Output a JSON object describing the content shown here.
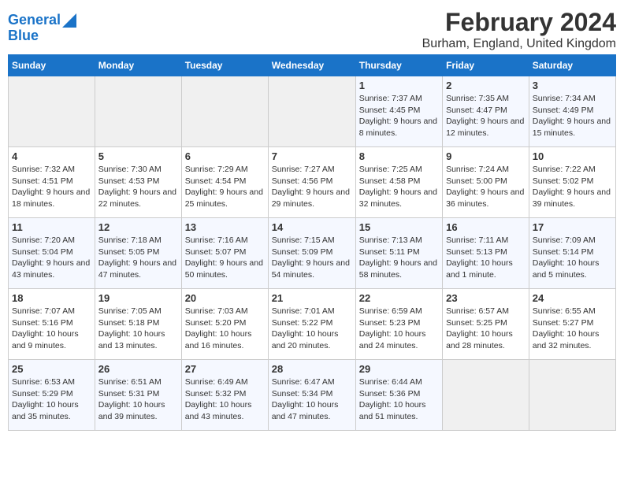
{
  "header": {
    "logo_line1": "General",
    "logo_line2": "Blue",
    "title": "February 2024",
    "subtitle": "Burham, England, United Kingdom"
  },
  "columns": [
    "Sunday",
    "Monday",
    "Tuesday",
    "Wednesday",
    "Thursday",
    "Friday",
    "Saturday"
  ],
  "weeks": [
    [
      {
        "day": "",
        "info": ""
      },
      {
        "day": "",
        "info": ""
      },
      {
        "day": "",
        "info": ""
      },
      {
        "day": "",
        "info": ""
      },
      {
        "day": "1",
        "info": "Sunrise: 7:37 AM\nSunset: 4:45 PM\nDaylight: 9 hours\nand 8 minutes."
      },
      {
        "day": "2",
        "info": "Sunrise: 7:35 AM\nSunset: 4:47 PM\nDaylight: 9 hours\nand 12 minutes."
      },
      {
        "day": "3",
        "info": "Sunrise: 7:34 AM\nSunset: 4:49 PM\nDaylight: 9 hours\nand 15 minutes."
      }
    ],
    [
      {
        "day": "4",
        "info": "Sunrise: 7:32 AM\nSunset: 4:51 PM\nDaylight: 9 hours\nand 18 minutes."
      },
      {
        "day": "5",
        "info": "Sunrise: 7:30 AM\nSunset: 4:53 PM\nDaylight: 9 hours\nand 22 minutes."
      },
      {
        "day": "6",
        "info": "Sunrise: 7:29 AM\nSunset: 4:54 PM\nDaylight: 9 hours\nand 25 minutes."
      },
      {
        "day": "7",
        "info": "Sunrise: 7:27 AM\nSunset: 4:56 PM\nDaylight: 9 hours\nand 29 minutes."
      },
      {
        "day": "8",
        "info": "Sunrise: 7:25 AM\nSunset: 4:58 PM\nDaylight: 9 hours\nand 32 minutes."
      },
      {
        "day": "9",
        "info": "Sunrise: 7:24 AM\nSunset: 5:00 PM\nDaylight: 9 hours\nand 36 minutes."
      },
      {
        "day": "10",
        "info": "Sunrise: 7:22 AM\nSunset: 5:02 PM\nDaylight: 9 hours\nand 39 minutes."
      }
    ],
    [
      {
        "day": "11",
        "info": "Sunrise: 7:20 AM\nSunset: 5:04 PM\nDaylight: 9 hours\nand 43 minutes."
      },
      {
        "day": "12",
        "info": "Sunrise: 7:18 AM\nSunset: 5:05 PM\nDaylight: 9 hours\nand 47 minutes."
      },
      {
        "day": "13",
        "info": "Sunrise: 7:16 AM\nSunset: 5:07 PM\nDaylight: 9 hours\nand 50 minutes."
      },
      {
        "day": "14",
        "info": "Sunrise: 7:15 AM\nSunset: 5:09 PM\nDaylight: 9 hours\nand 54 minutes."
      },
      {
        "day": "15",
        "info": "Sunrise: 7:13 AM\nSunset: 5:11 PM\nDaylight: 9 hours\nand 58 minutes."
      },
      {
        "day": "16",
        "info": "Sunrise: 7:11 AM\nSunset: 5:13 PM\nDaylight: 10 hours\nand 1 minute."
      },
      {
        "day": "17",
        "info": "Sunrise: 7:09 AM\nSunset: 5:14 PM\nDaylight: 10 hours\nand 5 minutes."
      }
    ],
    [
      {
        "day": "18",
        "info": "Sunrise: 7:07 AM\nSunset: 5:16 PM\nDaylight: 10 hours\nand 9 minutes."
      },
      {
        "day": "19",
        "info": "Sunrise: 7:05 AM\nSunset: 5:18 PM\nDaylight: 10 hours\nand 13 minutes."
      },
      {
        "day": "20",
        "info": "Sunrise: 7:03 AM\nSunset: 5:20 PM\nDaylight: 10 hours\nand 16 minutes."
      },
      {
        "day": "21",
        "info": "Sunrise: 7:01 AM\nSunset: 5:22 PM\nDaylight: 10 hours\nand 20 minutes."
      },
      {
        "day": "22",
        "info": "Sunrise: 6:59 AM\nSunset: 5:23 PM\nDaylight: 10 hours\nand 24 minutes."
      },
      {
        "day": "23",
        "info": "Sunrise: 6:57 AM\nSunset: 5:25 PM\nDaylight: 10 hours\nand 28 minutes."
      },
      {
        "day": "24",
        "info": "Sunrise: 6:55 AM\nSunset: 5:27 PM\nDaylight: 10 hours\nand 32 minutes."
      }
    ],
    [
      {
        "day": "25",
        "info": "Sunrise: 6:53 AM\nSunset: 5:29 PM\nDaylight: 10 hours\nand 35 minutes."
      },
      {
        "day": "26",
        "info": "Sunrise: 6:51 AM\nSunset: 5:31 PM\nDaylight: 10 hours\nand 39 minutes."
      },
      {
        "day": "27",
        "info": "Sunrise: 6:49 AM\nSunset: 5:32 PM\nDaylight: 10 hours\nand 43 minutes."
      },
      {
        "day": "28",
        "info": "Sunrise: 6:47 AM\nSunset: 5:34 PM\nDaylight: 10 hours\nand 47 minutes."
      },
      {
        "day": "29",
        "info": "Sunrise: 6:44 AM\nSunset: 5:36 PM\nDaylight: 10 hours\nand 51 minutes."
      },
      {
        "day": "",
        "info": ""
      },
      {
        "day": "",
        "info": ""
      }
    ]
  ]
}
